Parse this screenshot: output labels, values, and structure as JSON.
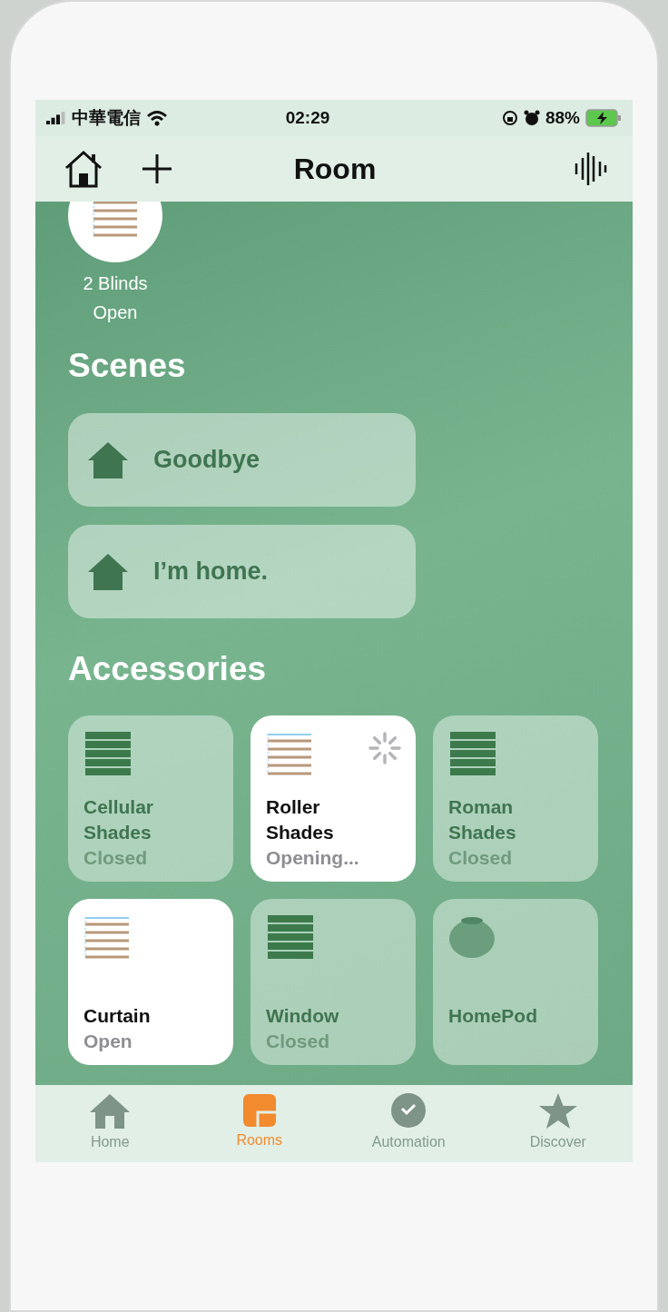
{
  "status_bar": {
    "carrier": "中華電信",
    "time": "02:29",
    "battery": "88%"
  },
  "nav": {
    "title": "Room"
  },
  "top_accessory": {
    "name": "2 Blinds",
    "status": "Open"
  },
  "scenes": {
    "heading": "Scenes",
    "items": [
      {
        "label": "Goodbye"
      },
      {
        "label": "I’m home."
      }
    ]
  },
  "accessories": {
    "heading": "Accessories",
    "items": [
      {
        "kind": "blinds",
        "name": "Cellular Shades",
        "status": "Closed",
        "on": false,
        "loading": false
      },
      {
        "kind": "blinds",
        "name": "Roller Shades",
        "status": "Opening...",
        "on": true,
        "loading": true
      },
      {
        "kind": "blinds",
        "name": "Roman Shades",
        "status": "Closed",
        "on": false,
        "loading": false
      },
      {
        "kind": "blinds",
        "name": "Curtain",
        "status": "Open",
        "on": true,
        "loading": false
      },
      {
        "kind": "blinds",
        "name": "Window",
        "status": "Closed",
        "on": false,
        "loading": false
      },
      {
        "kind": "speaker",
        "name": "HomePod",
        "on": false,
        "loading": false
      }
    ]
  },
  "tab_bar": [
    {
      "kind": "home",
      "label": "Home",
      "selected": false
    },
    {
      "kind": "rooms",
      "label": "Rooms",
      "selected": true
    },
    {
      "kind": "automation",
      "label": "Automation",
      "selected": false
    },
    {
      "kind": "discover",
      "label": "Discover",
      "selected": false
    }
  ]
}
